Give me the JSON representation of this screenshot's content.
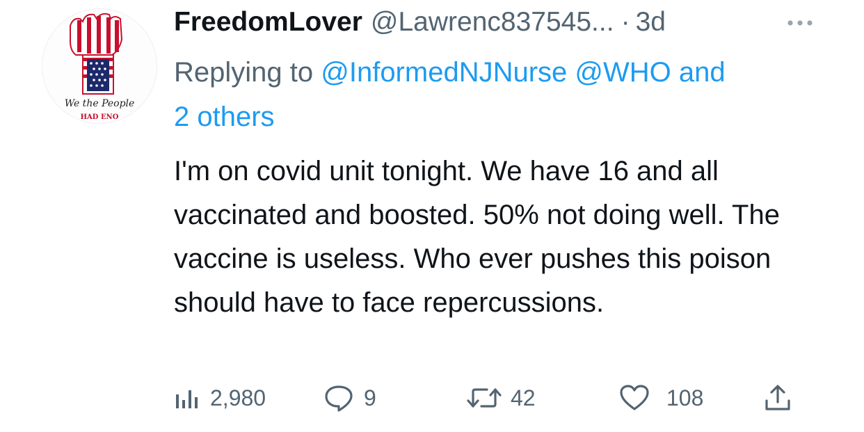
{
  "author": {
    "display_name": "FreedomLover",
    "handle": "@Lawrenc837545...",
    "separator": "·",
    "time": "3d",
    "avatar_text_top": "We the People",
    "avatar_text_bottom": "HAD ENO"
  },
  "reply": {
    "prefix": "Replying to ",
    "mention_1": "@InformedNJNurse",
    "mention_2": "@WHO",
    "conjunction": "and",
    "others": "2 others"
  },
  "tweet": {
    "text": "I'm on covid unit tonight. We have 16 and all vaccinated and boosted. 50% not doing well. The vaccine is useless. Who ever pushes this poison should have to face repercussions."
  },
  "actions": {
    "views": {
      "icon": "views-icon",
      "count": "2,980"
    },
    "reply": {
      "icon": "reply-icon",
      "count": "9"
    },
    "retweet": {
      "icon": "retweet-icon",
      "count": "42"
    },
    "like": {
      "icon": "heart-icon",
      "count": "108"
    },
    "share": {
      "icon": "share-icon"
    },
    "more": {
      "icon": "more-dots-icon"
    }
  },
  "colors": {
    "text": "#0f1419",
    "secondary": "#536471",
    "link": "#1d9bf0",
    "flag_red": "#c8102e",
    "flag_blue": "#1c2a6b"
  }
}
